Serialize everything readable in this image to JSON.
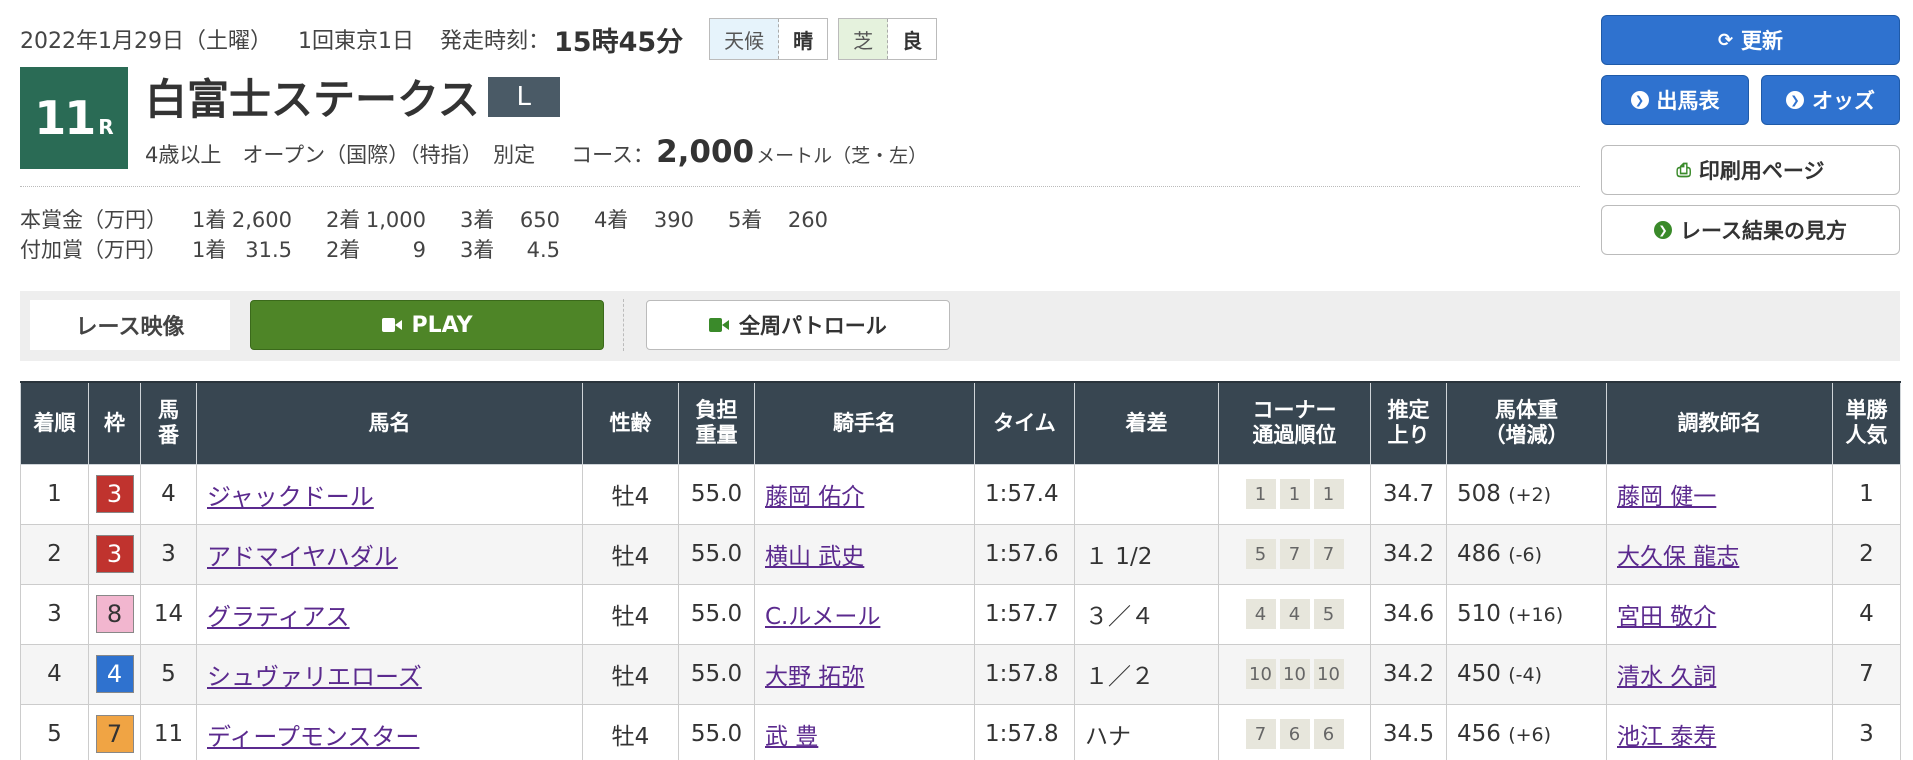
{
  "header": {
    "date": "2022年1月29日（土曜）",
    "meeting": "1回東京1日",
    "post_time_label": "発走時刻：",
    "post_time": "15時45分",
    "weather_label": "天候",
    "weather": "晴",
    "track_label": "芝",
    "track_condition": "良"
  },
  "race": {
    "number": "11",
    "number_suffix": "R",
    "name": "白富士ステークス",
    "grade": "L",
    "conditions": "4歳以上　オープン（国際）（特指）　別定",
    "course_label": "コース：",
    "distance": "2,000",
    "distance_unit": "メートル（芝・左）"
  },
  "prize": {
    "main": {
      "label": "本賞金（万円）",
      "items": [
        {
          "pos": "1着",
          "val": "2,600"
        },
        {
          "pos": "2着",
          "val": "1,000"
        },
        {
          "pos": "3着",
          "val": "650"
        },
        {
          "pos": "4着",
          "val": "390"
        },
        {
          "pos": "5着",
          "val": "260"
        }
      ]
    },
    "extra": {
      "label": "付加賞（万円）",
      "items": [
        {
          "pos": "1着",
          "val": "31.5"
        },
        {
          "pos": "2着",
          "val": "9"
        },
        {
          "pos": "3着",
          "val": "4.5"
        }
      ]
    }
  },
  "buttons": {
    "refresh": "更新",
    "entries": "出馬表",
    "odds": "オッズ",
    "print": "印刷用ページ",
    "howto": "レース結果の見方"
  },
  "video": {
    "label": "レース映像",
    "play": "PLAY",
    "patrol": "全周パトロール"
  },
  "table": {
    "headers": {
      "rank": "着順",
      "waku": "枠",
      "umaban": "馬\n番",
      "horse": "馬名",
      "sexage": "性齢",
      "weight": "負担\n重量",
      "jockey": "騎手名",
      "time": "タイム",
      "margin": "着差",
      "corner": "コーナー\n通過順位",
      "last3f": "推定\n上り",
      "body": "馬体重\n（増減）",
      "trainer": "調教師名",
      "pop": "単勝\n人気"
    },
    "rows": [
      {
        "rank": "1",
        "waku": "3",
        "waku_bg": "#c0332e",
        "waku_fg": "#ffffff",
        "umaban": "4",
        "horse": "ジャックドール",
        "sexage": "牡4",
        "weight": "55.0",
        "jockey": "藤岡 佑介",
        "time": "1:57.4",
        "margin": "",
        "corner": [
          "1",
          "1",
          "1"
        ],
        "last3f": "34.7",
        "body": "508",
        "body_diff": "(+2)",
        "trainer": "藤岡 健一",
        "pop": "1"
      },
      {
        "rank": "2",
        "waku": "3",
        "waku_bg": "#c0332e",
        "waku_fg": "#ffffff",
        "umaban": "3",
        "horse": "アドマイヤハダル",
        "sexage": "牡4",
        "weight": "55.0",
        "jockey": "横山 武史",
        "time": "1:57.6",
        "margin": "１ 1/2",
        "corner": [
          "5",
          "7",
          "7"
        ],
        "last3f": "34.2",
        "body": "486",
        "body_diff": "(-6)",
        "trainer": "大久保 龍志",
        "pop": "2"
      },
      {
        "rank": "3",
        "waku": "8",
        "waku_bg": "#f2b6cf",
        "waku_fg": "#333333",
        "umaban": "14",
        "horse": "グラティアス",
        "sexage": "牡4",
        "weight": "55.0",
        "jockey": "C.ルメール",
        "time": "1:57.7",
        "margin": "３／４",
        "corner": [
          "4",
          "4",
          "5"
        ],
        "last3f": "34.6",
        "body": "510",
        "body_diff": "(+16)",
        "trainer": "宮田 敬介",
        "pop": "4"
      },
      {
        "rank": "4",
        "waku": "4",
        "waku_bg": "#2f72cf",
        "waku_fg": "#ffffff",
        "umaban": "5",
        "horse": "シュヴァリエローズ",
        "sexage": "牡4",
        "weight": "55.0",
        "jockey": "大野 拓弥",
        "time": "1:57.8",
        "margin": "１／２",
        "corner": [
          "10",
          "10",
          "10"
        ],
        "last3f": "34.2",
        "body": "450",
        "body_diff": "(-4)",
        "trainer": "清水 久詞",
        "pop": "7"
      },
      {
        "rank": "5",
        "waku": "7",
        "waku_bg": "#f0a444",
        "waku_fg": "#333333",
        "umaban": "11",
        "horse": "ディープモンスター",
        "sexage": "牡4",
        "weight": "55.0",
        "jockey": "武 豊",
        "time": "1:57.8",
        "margin": "ハナ",
        "corner": [
          "7",
          "6",
          "6"
        ],
        "last3f": "34.5",
        "body": "456",
        "body_diff": "(+6)",
        "trainer": "池江 泰寿",
        "pop": "3"
      }
    ]
  },
  "colors": {
    "badge": "#2a6b55",
    "header_bg": "#384651",
    "primary": "#2f72cf",
    "play": "#4e8527",
    "link": "#5b2a8e"
  }
}
